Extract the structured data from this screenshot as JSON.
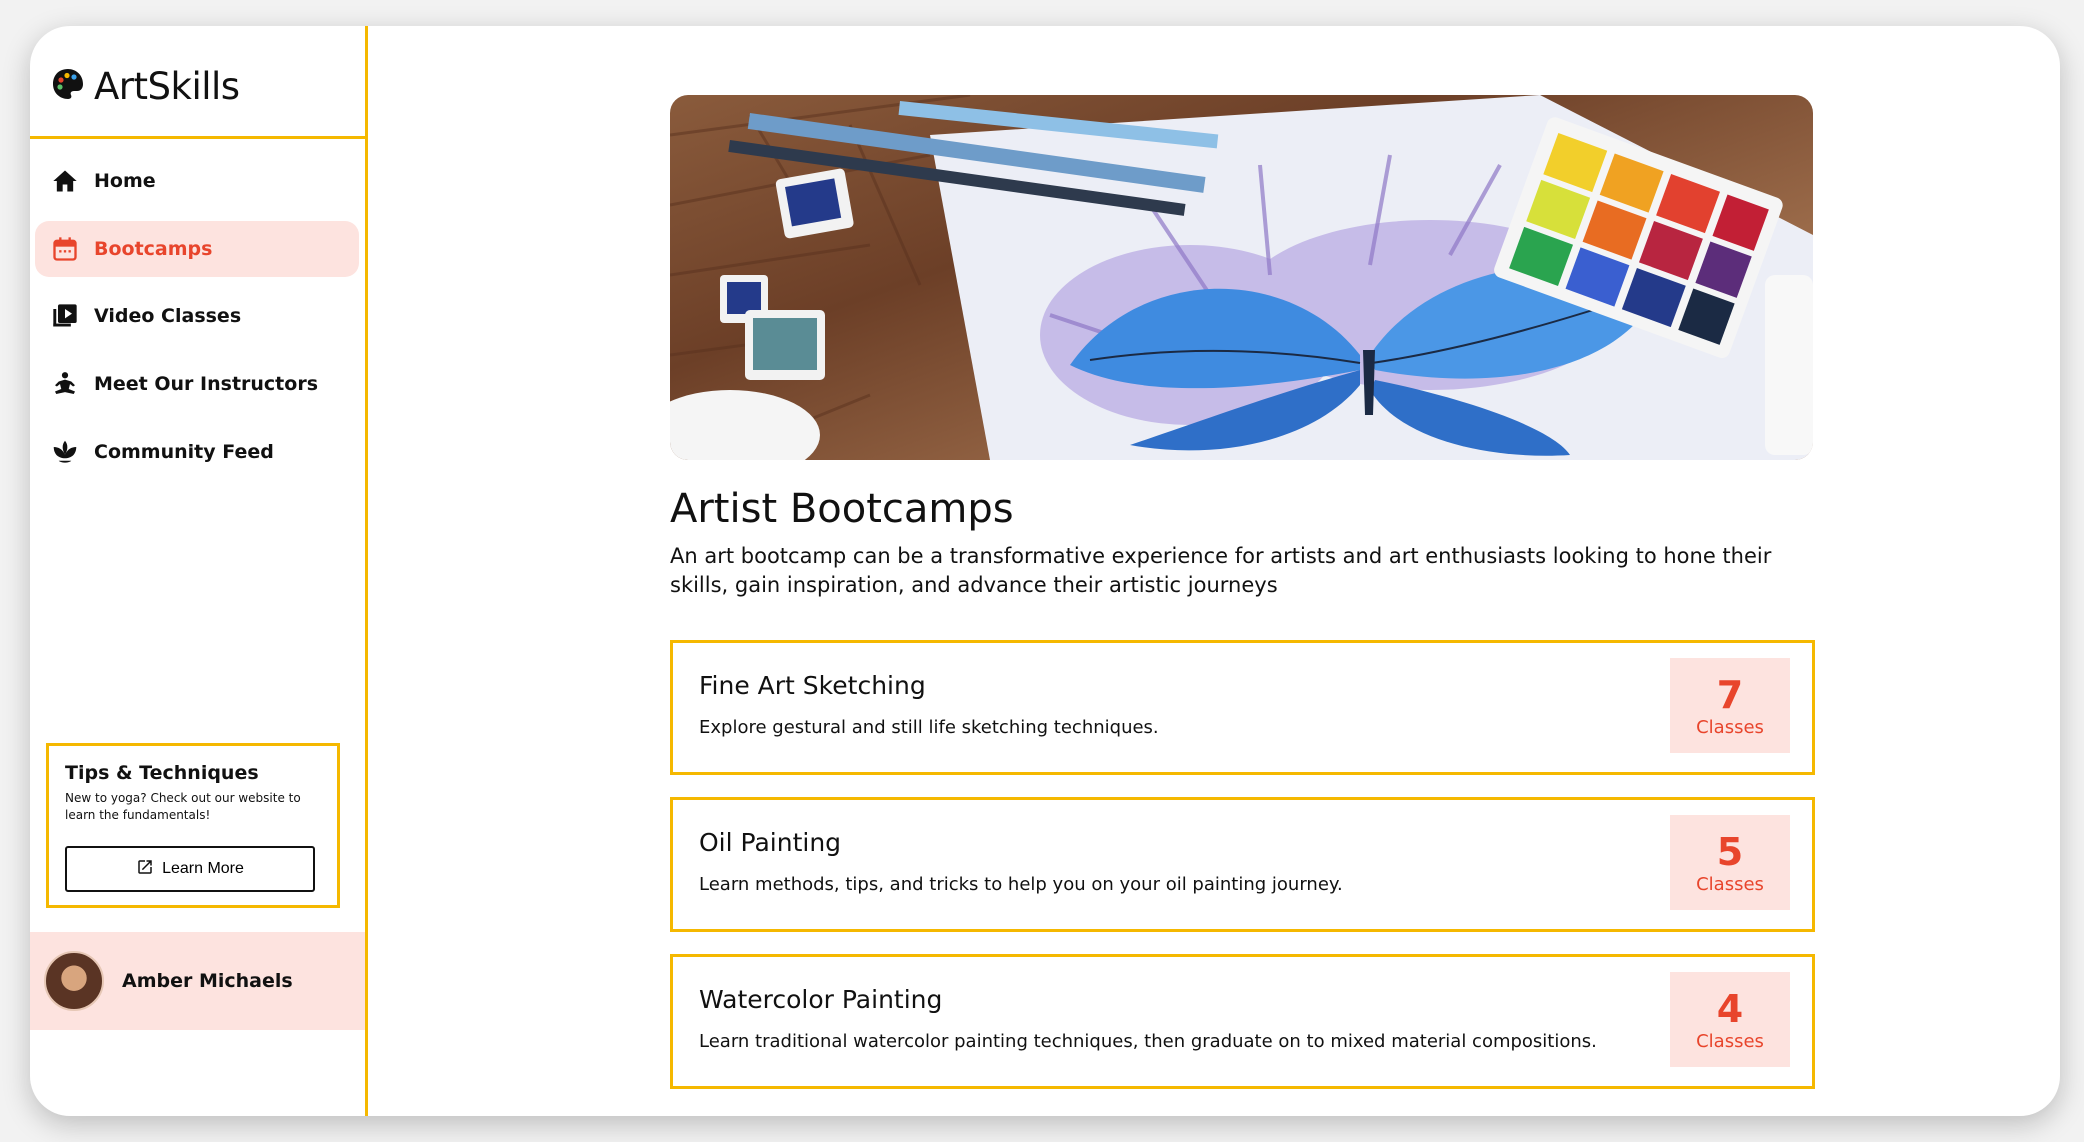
{
  "app": {
    "name": "ArtSkills",
    "logo_icon": "palette-icon",
    "colors": {
      "accent": "#f5b800",
      "active": "#e8452c",
      "active_bg": "#fde3df"
    }
  },
  "sidebar": {
    "items": [
      {
        "label": "Home",
        "icon": "home-icon",
        "active": false
      },
      {
        "label": "Bootcamps",
        "icon": "calendar-icon",
        "active": true
      },
      {
        "label": "Video Classes",
        "icon": "video-library-icon",
        "active": false
      },
      {
        "label": "Meet Our Instructors",
        "icon": "meditation-person-icon",
        "active": false
      },
      {
        "label": "Community Feed",
        "icon": "lotus-icon",
        "active": false
      }
    ],
    "tips": {
      "title": "Tips & Techniques",
      "text": "New to yoga? Check out our website to learn the fundamentals!",
      "button_label": "Learn More",
      "button_icon": "external-link-icon"
    },
    "user": {
      "name": "Amber Michaels"
    }
  },
  "main": {
    "title": "Artist Bootcamps",
    "description": "An art bootcamp can be a transformative experience for artists and art enthusiasts looking to hone their skills, gain inspiration, and advance their artistic journeys",
    "bootcamps": [
      {
        "title": "Fine Art Sketching",
        "description": "Explore gestural and still life sketching techniques.",
        "count": "7",
        "count_label": "Classes"
      },
      {
        "title": "Oil Painting",
        "description": "Learn methods, tips, and tricks to help you on your oil painting journey.",
        "count": "5",
        "count_label": "Classes"
      },
      {
        "title": "Watercolor Painting",
        "description": "Learn traditional watercolor painting techniques, then graduate on to mixed material compositions.",
        "count": "4",
        "count_label": "Classes"
      }
    ]
  }
}
